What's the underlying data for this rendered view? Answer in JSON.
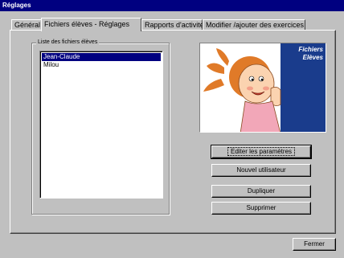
{
  "window": {
    "title": "Réglages"
  },
  "tabs": [
    {
      "label": "Général"
    },
    {
      "label": "Fichiers élèves - Réglages"
    },
    {
      "label": "Rapports d'activité"
    },
    {
      "label": "Modifier /ajouter des exercices"
    }
  ],
  "active_tab": "Fichiers élèves - Réglages",
  "students_group": {
    "label": "Liste des fichiers élèves",
    "items": [
      "Jean-Claude",
      "Milou"
    ],
    "selected": "Jean-Claude"
  },
  "illustration": {
    "icon": "girl-peeking-illustration",
    "caption_line1": "Fichiers",
    "caption_line2": "Elèves",
    "panel_color": "#1a3c8c"
  },
  "buttons": {
    "edit_params": "Editer les paramètres",
    "new_user": "Nouvel utilisateur",
    "duplicate": "Dupliquer",
    "delete": "Supprimer",
    "close": "Fermer"
  },
  "colors": {
    "titlebar": "#000080",
    "selection": "#000080",
    "face": "#c0c0c0"
  }
}
